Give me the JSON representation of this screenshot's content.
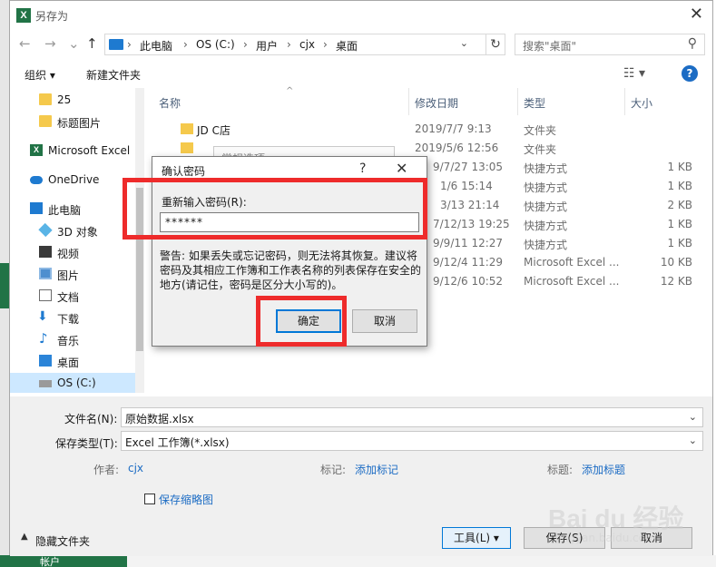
{
  "window": {
    "title": "另存为",
    "close": "✕"
  },
  "nav": {
    "back": "←",
    "forward": "→",
    "up": "↑",
    "breadcrumb": [
      "此电脑",
      "OS (C:)",
      "用户",
      "cjx",
      "桌面"
    ],
    "refresh": "↻",
    "search_placeholder": "搜索\"桌面\""
  },
  "toolbar": {
    "organize": "组织 ▾",
    "new_folder": "新建文件夹",
    "view": "☷ ▾",
    "help": "?"
  },
  "sidebar": {
    "items": [
      {
        "label": "25",
        "icon": "folder-icon"
      },
      {
        "label": "标题图片",
        "icon": "folder-icon"
      },
      {
        "label": "Microsoft Excel",
        "icon": "excel-icon"
      },
      {
        "label": "OneDrive",
        "icon": "cloud-icon"
      },
      {
        "label": "此电脑",
        "icon": "computer-icon"
      },
      {
        "label": "3D 对象",
        "icon": "cube-icon"
      },
      {
        "label": "视频",
        "icon": "video-icon"
      },
      {
        "label": "图片",
        "icon": "picture-icon"
      },
      {
        "label": "文档",
        "icon": "document-icon"
      },
      {
        "label": "下载",
        "icon": "download-icon"
      },
      {
        "label": "音乐",
        "icon": "music-icon"
      },
      {
        "label": "桌面",
        "icon": "desktop-icon"
      },
      {
        "label": "OS (C:)",
        "icon": "drive-icon"
      }
    ]
  },
  "files": {
    "columns": {
      "name": "名称",
      "date": "修改日期",
      "type": "类型",
      "size": "大小"
    },
    "sort_indicator": "^",
    "rows": [
      {
        "name": "JD C店",
        "date": "2019/7/7 9:13",
        "type": "文件夹",
        "size": ""
      },
      {
        "name": "",
        "date": "2019/5/6 12:56",
        "type": "文件夹",
        "size": ""
      },
      {
        "name": "",
        "date": "9/7/27 13:05",
        "type": "快捷方式",
        "size": "1 KB"
      },
      {
        "name": "",
        "date": "1/6 15:14",
        "type": "快捷方式",
        "size": "1 KB"
      },
      {
        "name": "",
        "date": "3/13 21:14",
        "type": "快捷方式",
        "size": "2 KB"
      },
      {
        "name": "",
        "date": "7/12/13 19:25",
        "type": "快捷方式",
        "size": "1 KB"
      },
      {
        "name": "",
        "date": "9/9/11 12:27",
        "type": "快捷方式",
        "size": "1 KB"
      },
      {
        "name": "",
        "date": "9/12/4 11:29",
        "type": "Microsoft Excel ...",
        "size": "10 KB"
      },
      {
        "name": "",
        "date": "9/12/6 10:52",
        "type": "Microsoft Excel ...",
        "size": "12 KB"
      }
    ]
  },
  "form": {
    "filename_label": "文件名(N):",
    "filename_value": "原始数据.xlsx",
    "filetype_label": "保存类型(T):",
    "filetype_value": "Excel 工作簿(*.xlsx)",
    "author_label": "作者:",
    "author_value": "cjx",
    "tags_label": "标记:",
    "tags_value": "添加标记",
    "title_label": "标题:",
    "title_value": "添加标题",
    "thumbnail_label": "保存缩略图",
    "hide_folders": "隐藏文件夹",
    "tools_button": "工具(L)",
    "tools_caret": "▾",
    "save_button": "保存(S)",
    "cancel_button": "取消"
  },
  "password_dialog": {
    "title": "确认密码",
    "help": "?",
    "close": "✕",
    "label": "重新输入密码(R):",
    "value": "******",
    "warning": "警告: 如果丢失或忘记密码，则无法将其恢复。建议将密码及其相应工作簿和工作表名称的列表保存在安全的地方(请记住，密码是区分大小写的)。",
    "ok": "确定",
    "cancel": "取消"
  },
  "behind_dialog": {
    "text": "常规选项"
  },
  "excel_bg": {
    "text": "帐户"
  },
  "watermark": {
    "brand": "Bai du 经验",
    "url": "jingyan.baidu.com"
  },
  "colors": {
    "accent": "#1c6cc4",
    "excel_green": "#217346",
    "highlight": "#ee2b2b",
    "selection": "#cde8ff"
  }
}
